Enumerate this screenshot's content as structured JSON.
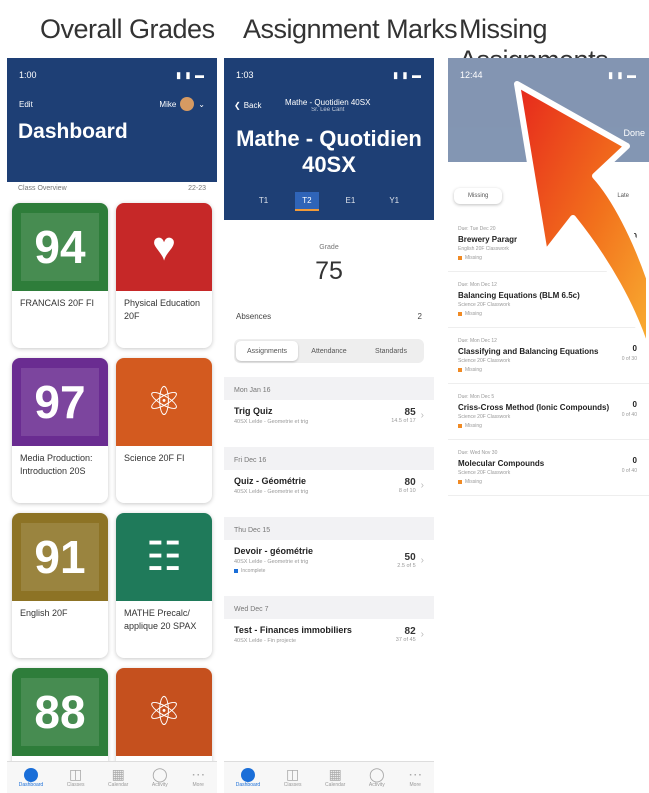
{
  "headings": [
    "Overall Grades",
    "Assignment Marks",
    "Missing Assignments"
  ],
  "status_time": "1:00",
  "status_time_2": "1:03",
  "status_time_3": "12:44",
  "status_right": "▮ ▮ ▬",
  "phone1": {
    "edit": "Edit",
    "user": "Mike",
    "title": "Dashboard",
    "section": "Class Overview",
    "year": "22-23",
    "cards": [
      {
        "grade": "94",
        "name": "FRANCAIS 20F FI",
        "color": "#2e7d3a",
        "icon": ""
      },
      {
        "grade": "",
        "name": "Physical Education 20F",
        "color": "#c62828",
        "icon": "♥"
      },
      {
        "grade": "97",
        "name": "Media Production: Introduction 20S",
        "color": "#6a2c91",
        "icon": ""
      },
      {
        "grade": "",
        "name": "Science 20F FI",
        "color": "#d35a1f",
        "icon": "⚛"
      },
      {
        "grade": "91",
        "name": "English 20F",
        "color": "#8d7325",
        "icon": ""
      },
      {
        "grade": "",
        "name": "MATHE Precalc/ applique 20 SPAX",
        "color": "#1f7a5a",
        "icon": "☷"
      },
      {
        "grade": "88",
        "name": "",
        "color": "#2e7d3a",
        "icon": ""
      },
      {
        "grade": "",
        "name": "",
        "color": "#c5501e",
        "icon": "⚛"
      }
    ]
  },
  "phone2": {
    "back": "Back",
    "course_small": "Mathe - Quotidien 40SX",
    "course_sub": "Sr. Lee Cant",
    "course_big": "Mathe - Quotidien 40SX",
    "terms": [
      "T1",
      "T2",
      "E1",
      "Y1"
    ],
    "grade_label": "Grade",
    "grade": "75",
    "absences_label": "Absences",
    "absences": "2",
    "segments": [
      "Assignments",
      "Attendance",
      "Standards"
    ],
    "groups": [
      {
        "date": "Mon Jan 16",
        "name": "Trig Quiz",
        "cat": "40SX Lelde - Geometrie et trig",
        "score": "85",
        "out": "14.5 of 17",
        "badge": "",
        "badge_color": ""
      },
      {
        "date": "Fri Dec 16",
        "name": "Quiz - Géométrie",
        "cat": "40SX Lelde - Geometrie et trig",
        "score": "80",
        "out": "8 of 10",
        "badge": "",
        "badge_color": ""
      },
      {
        "date": "Thu Dec 15",
        "name": "Devoir - géométrie",
        "cat": "40SX Lelde - Geometrie et trig",
        "score": "50",
        "out": "2.5 of 5",
        "badge": "Incomplete",
        "badge_color": "#1a6ed8"
      },
      {
        "date": "Wed Dec 7",
        "name": "Test - Finances immobiliers",
        "cat": "40SX Lelde - Fin projecte",
        "score": "82",
        "out": "37 of 45",
        "badge": "",
        "badge_color": ""
      }
    ]
  },
  "phone3": {
    "done": "Done",
    "tabs": [
      "Missing",
      "Late"
    ],
    "items": [
      {
        "due": "Due: Tue Dec 20",
        "name": "Brewery Paragr",
        "cat": "English 20F Classwork",
        "badge": "Missing",
        "score": "0",
        "out": ""
      },
      {
        "due": "Due: Mon Dec 12",
        "name": "Balancing Equations (BLM 6.5c)",
        "cat": "Science 20F Classwork",
        "badge": "Missing",
        "score": "",
        "out": ""
      },
      {
        "due": "Due: Mon Dec 12",
        "name": "Classifying and Balancing Equations",
        "cat": "Science 20F Classwork",
        "badge": "Missing",
        "score": "0",
        "out": "0 of 30"
      },
      {
        "due": "Due: Mon Dec 5",
        "name": "Criss-Cross Method (Ionic Compounds)",
        "cat": "Science 20F Classwork",
        "badge": "Missing",
        "score": "0",
        "out": "0 of 40"
      },
      {
        "due": "Due: Wed Nov 30",
        "name": "Molecular Compounds",
        "cat": "Science 20F Classwork",
        "badge": "Missing",
        "score": "0",
        "out": "0 of 40"
      }
    ]
  },
  "tabbar": [
    "Dashboard",
    "Classes",
    "Calendar",
    "Activity",
    "More"
  ],
  "colors": {
    "navbar": "#1e3f75",
    "accent": "#1a6ed8",
    "missing": "#f08a24",
    "arrow": "#f2711c"
  }
}
